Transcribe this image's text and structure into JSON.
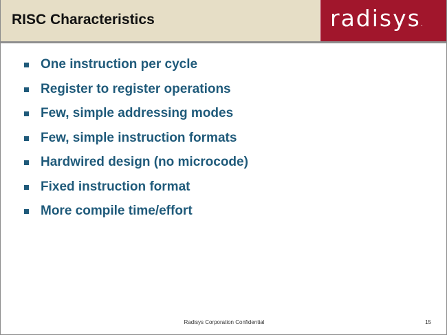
{
  "slide": {
    "title": "RISC Characteristics",
    "logo": {
      "text": "radisys",
      "trademark": ".",
      "color": "#a1162c"
    },
    "bullets": [
      "One instruction per cycle",
      "Register to register operations",
      "Few, simple addressing modes",
      "Few, simple instruction formats",
      "Hardwired design (no microcode)",
      "Fixed instruction format",
      "More compile time/effort"
    ],
    "footer": "Radisys Corporation Confidential",
    "page_number": "15",
    "colors": {
      "title_bar": "#e6dec6",
      "bullet_text": "#1f5a7a",
      "divider": "#8e8e8e"
    }
  }
}
